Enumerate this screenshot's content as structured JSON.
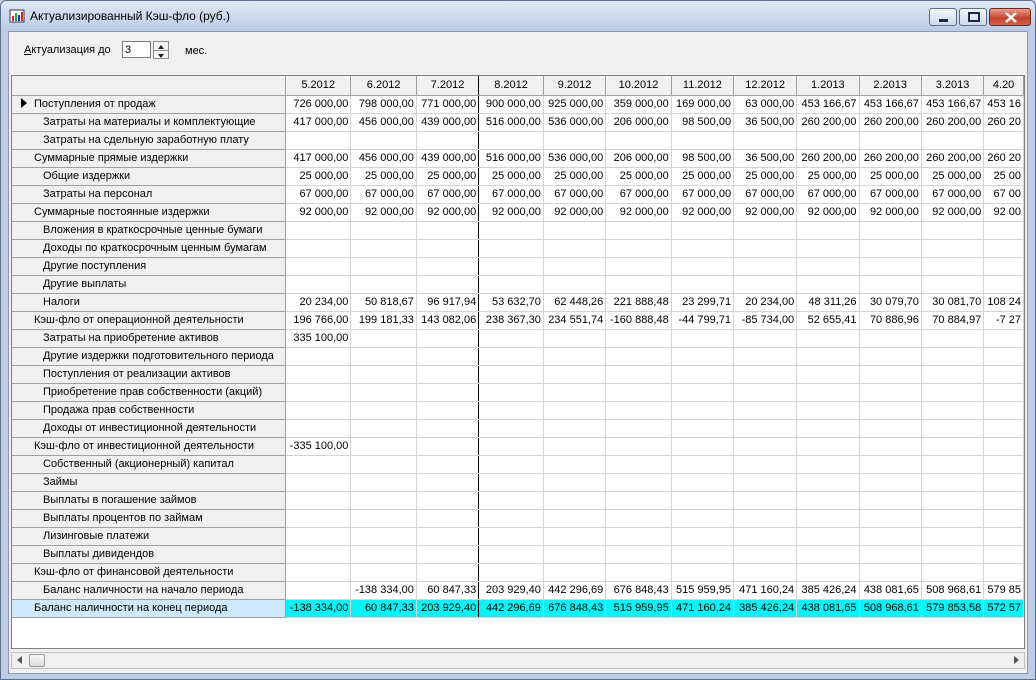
{
  "window": {
    "title": "Актуализированный Кэш-фло (руб.)"
  },
  "toolbar": {
    "actualization_label": "Актуализация до",
    "months_value": "3",
    "unit_label": "мес."
  },
  "table": {
    "columns": [
      "5.2012",
      "6.2012",
      "7.2012",
      "8.2012",
      "9.2012",
      "10.2012",
      "11.2012",
      "12.2012",
      "1.2013",
      "2.2013",
      "3.2013",
      "4.20"
    ],
    "rows": [
      {
        "label": "Поступления от продаж",
        "level": 1,
        "current": true,
        "values": [
          "726 000,00",
          "798 000,00",
          "771 000,00",
          "900 000,00",
          "925 000,00",
          "359 000,00",
          "169 000,00",
          "63 000,00",
          "453 166,67",
          "453 166,67",
          "453 166,67",
          "453 16"
        ]
      },
      {
        "label": "Затраты на материалы и комплектующие",
        "level": 2,
        "values": [
          "417 000,00",
          "456 000,00",
          "439 000,00",
          "516 000,00",
          "536 000,00",
          "206 000,00",
          "98 500,00",
          "36 500,00",
          "260 200,00",
          "260 200,00",
          "260 200,00",
          "260 20"
        ]
      },
      {
        "label": "Затраты на сдельную заработную плату",
        "level": 2,
        "values": [
          "",
          "",
          "",
          "",
          "",
          "",
          "",
          "",
          "",
          "",
          "",
          ""
        ]
      },
      {
        "label": "Суммарные прямые издержки",
        "level": 1,
        "values": [
          "417 000,00",
          "456 000,00",
          "439 000,00",
          "516 000,00",
          "536 000,00",
          "206 000,00",
          "98 500,00",
          "36 500,00",
          "260 200,00",
          "260 200,00",
          "260 200,00",
          "260 20"
        ]
      },
      {
        "label": "Общие издержки",
        "level": 2,
        "values": [
          "25 000,00",
          "25 000,00",
          "25 000,00",
          "25 000,00",
          "25 000,00",
          "25 000,00",
          "25 000,00",
          "25 000,00",
          "25 000,00",
          "25 000,00",
          "25 000,00",
          "25 00"
        ]
      },
      {
        "label": "Затраты на персонал",
        "level": 2,
        "values": [
          "67 000,00",
          "67 000,00",
          "67 000,00",
          "67 000,00",
          "67 000,00",
          "67 000,00",
          "67 000,00",
          "67 000,00",
          "67 000,00",
          "67 000,00",
          "67 000,00",
          "67 00"
        ]
      },
      {
        "label": "Суммарные постоянные издержки",
        "level": 1,
        "values": [
          "92 000,00",
          "92 000,00",
          "92 000,00",
          "92 000,00",
          "92 000,00",
          "92 000,00",
          "92 000,00",
          "92 000,00",
          "92 000,00",
          "92 000,00",
          "92 000,00",
          "92 00"
        ]
      },
      {
        "label": "Вложения в краткосрочные ценные бумаги",
        "level": 2,
        "values": [
          "",
          "",
          "",
          "",
          "",
          "",
          "",
          "",
          "",
          "",
          "",
          ""
        ]
      },
      {
        "label": "Доходы по краткосрочным ценным бумагам",
        "level": 2,
        "values": [
          "",
          "",
          "",
          "",
          "",
          "",
          "",
          "",
          "",
          "",
          "",
          ""
        ]
      },
      {
        "label": "Другие поступления",
        "level": 2,
        "values": [
          "",
          "",
          "",
          "",
          "",
          "",
          "",
          "",
          "",
          "",
          "",
          ""
        ]
      },
      {
        "label": "Другие выплаты",
        "level": 2,
        "values": [
          "",
          "",
          "",
          "",
          "",
          "",
          "",
          "",
          "",
          "",
          "",
          ""
        ]
      },
      {
        "label": "Налоги",
        "level": 2,
        "values": [
          "20 234,00",
          "50 818,67",
          "96 917,94",
          "53 632,70",
          "62 448,26",
          "221 888,48",
          "23 299,71",
          "20 234,00",
          "48 311,26",
          "30 079,70",
          "30 081,70",
          "108 24"
        ]
      },
      {
        "label": "Кэш-фло от операционной деятельности",
        "level": 1,
        "values": [
          "196 766,00",
          "199 181,33",
          "143 082,06",
          "238 367,30",
          "234 551,74",
          "-160 888,48",
          "-44 799,71",
          "-85 734,00",
          "52 655,41",
          "70 886,96",
          "70 884,97",
          "-7 27"
        ]
      },
      {
        "label": "Затраты на приобретение активов",
        "level": 2,
        "values": [
          "335 100,00",
          "",
          "",
          "",
          "",
          "",
          "",
          "",
          "",
          "",
          "",
          ""
        ]
      },
      {
        "label": "Другие издержки подготовительного периода",
        "level": 2,
        "values": [
          "",
          "",
          "",
          "",
          "",
          "",
          "",
          "",
          "",
          "",
          "",
          ""
        ]
      },
      {
        "label": "Поступления от реализации активов",
        "level": 2,
        "values": [
          "",
          "",
          "",
          "",
          "",
          "",
          "",
          "",
          "",
          "",
          "",
          ""
        ]
      },
      {
        "label": "Приобретение прав собственности (акций)",
        "level": 2,
        "values": [
          "",
          "",
          "",
          "",
          "",
          "",
          "",
          "",
          "",
          "",
          "",
          ""
        ]
      },
      {
        "label": "Продажа прав собственности",
        "level": 2,
        "values": [
          "",
          "",
          "",
          "",
          "",
          "",
          "",
          "",
          "",
          "",
          "",
          ""
        ]
      },
      {
        "label": "Доходы от инвестиционной деятельности",
        "level": 2,
        "values": [
          "",
          "",
          "",
          "",
          "",
          "",
          "",
          "",
          "",
          "",
          "",
          ""
        ]
      },
      {
        "label": "Кэш-фло от инвестиционной деятельности",
        "level": 1,
        "values": [
          "-335 100,00",
          "",
          "",
          "",
          "",
          "",
          "",
          "",
          "",
          "",
          "",
          ""
        ]
      },
      {
        "label": "Собственный (акционерный) капитал",
        "level": 2,
        "values": [
          "",
          "",
          "",
          "",
          "",
          "",
          "",
          "",
          "",
          "",
          "",
          ""
        ]
      },
      {
        "label": "Займы",
        "level": 2,
        "values": [
          "",
          "",
          "",
          "",
          "",
          "",
          "",
          "",
          "",
          "",
          "",
          ""
        ]
      },
      {
        "label": "Выплаты в погашение займов",
        "level": 2,
        "values": [
          "",
          "",
          "",
          "",
          "",
          "",
          "",
          "",
          "",
          "",
          "",
          ""
        ]
      },
      {
        "label": "Выплаты процентов по займам",
        "level": 2,
        "values": [
          "",
          "",
          "",
          "",
          "",
          "",
          "",
          "",
          "",
          "",
          "",
          ""
        ]
      },
      {
        "label": "Лизинговые платежи",
        "level": 2,
        "values": [
          "",
          "",
          "",
          "",
          "",
          "",
          "",
          "",
          "",
          "",
          "",
          ""
        ]
      },
      {
        "label": "Выплаты дивидендов",
        "level": 2,
        "values": [
          "",
          "",
          "",
          "",
          "",
          "",
          "",
          "",
          "",
          "",
          "",
          ""
        ]
      },
      {
        "label": "Кэш-фло от финансовой деятельности",
        "level": 1,
        "values": [
          "",
          "",
          "",
          "",
          "",
          "",
          "",
          "",
          "",
          "",
          "",
          ""
        ]
      },
      {
        "label": "Баланс наличности на начало периода",
        "level": 2,
        "values": [
          "",
          "-138 334,00",
          "60 847,33",
          "203 929,40",
          "442 296,69",
          "676 848,43",
          "515 959,95",
          "471 160,24",
          "385 426,24",
          "438 081,65",
          "508 968,61",
          "579 85"
        ]
      },
      {
        "label": "Баланс наличности на конец периода",
        "level": 1,
        "highlight": true,
        "values": [
          "-138 334,00",
          "60 847,33",
          "203 929,40",
          "442 296,69",
          "676 848,43",
          "515 959,95",
          "471 160,24",
          "385 426,24",
          "438 081,65",
          "508 968,61",
          "579 853,58",
          "572 57"
        ]
      }
    ]
  },
  "colors": {
    "highlight_cells": "#00f7f7",
    "highlight_label": "#cfe8fb"
  }
}
